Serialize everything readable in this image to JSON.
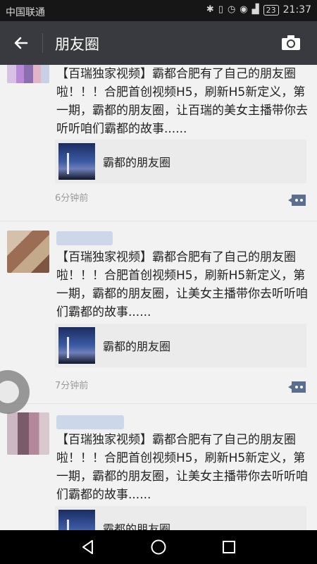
{
  "status_bar": {
    "carrier": "中国联通",
    "battery": "23",
    "time": "21:37"
  },
  "nav": {
    "title": "朋友圈",
    "back_icon": "back-arrow-icon",
    "camera_icon": "camera-icon"
  },
  "posts": [
    {
      "text": "【百瑞独家视频】霸都合肥有了自己的朋友圈啦！！！合肥首创视频H5，刷新H5新定义，第一期，霸都的朋友圈，让百瑞的美女主播带你去听听咱们霸都的故事......",
      "link_title": "霸都的朋友圈",
      "time": "6分钟前"
    },
    {
      "text": "【百瑞独家视频】霸都合肥有了自己的朋友圈啦！！！合肥首创视频H5，刷新H5新定义，第一期，霸都的朋友圈，让美女主播带你去听听咱们霸都的故事......",
      "link_title": "霸都的朋友圈",
      "time": "7分钟前"
    },
    {
      "text": "【百瑞独家视频】霸都合肥有了自己的朋友圈啦！！！合肥首创视频H5，刷新H5新定义，第一期，霸都的朋友圈，让美女主播带你去听听咱们霸都的故事......",
      "link_title": "霸都的朋友圈"
    }
  ],
  "colors": {
    "nav_bg": "#393a3f",
    "status_bg": "#161616",
    "page_bg": "#f2f2f2",
    "comment_icon": "#5b6e8f"
  }
}
